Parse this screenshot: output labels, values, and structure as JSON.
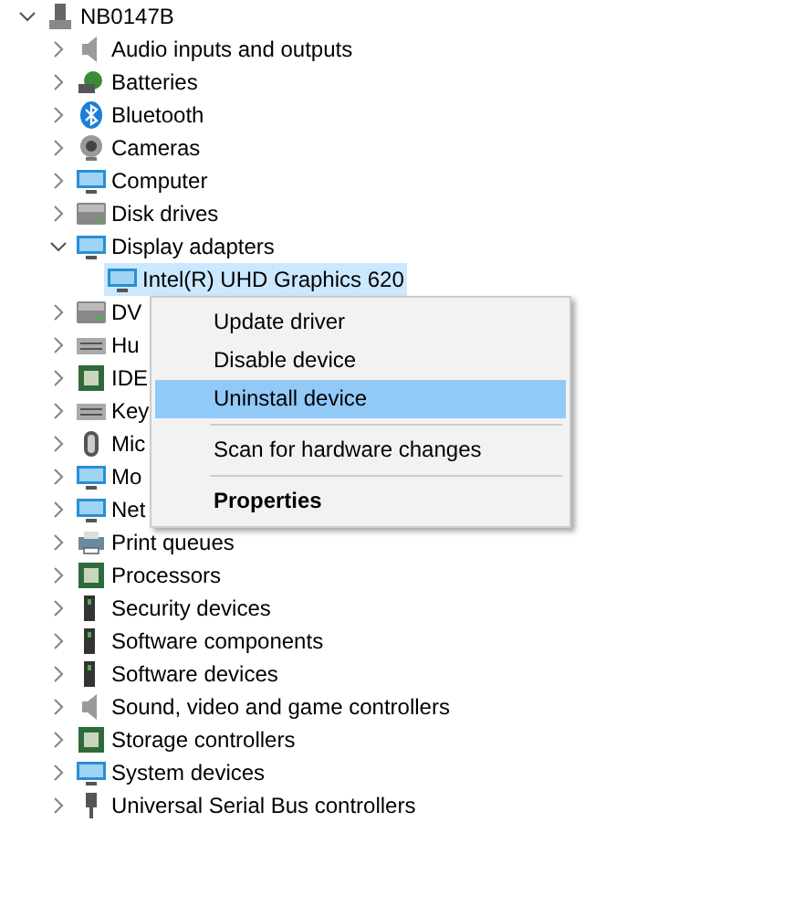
{
  "tree": {
    "label": "NB0147B",
    "expanded": true,
    "selected": false,
    "children": [
      {
        "label": "Audio inputs and outputs",
        "expanded": false,
        "selected": false
      },
      {
        "label": "Batteries",
        "expanded": false,
        "selected": false
      },
      {
        "label": "Bluetooth",
        "expanded": false,
        "selected": false
      },
      {
        "label": "Cameras",
        "expanded": false,
        "selected": false
      },
      {
        "label": "Computer",
        "expanded": false,
        "selected": false
      },
      {
        "label": "Disk drives",
        "expanded": false,
        "selected": false
      },
      {
        "label": "Display adapters",
        "expanded": true,
        "selected": false,
        "children": [
          {
            "label": "Intel(R) UHD Graphics 620",
            "selected": true
          }
        ]
      },
      {
        "label": "DV",
        "expanded": false,
        "selected": false
      },
      {
        "label": "Hu",
        "expanded": false,
        "selected": false
      },
      {
        "label": "IDE",
        "expanded": false,
        "selected": false
      },
      {
        "label": "Key",
        "expanded": false,
        "selected": false
      },
      {
        "label": "Mic",
        "expanded": false,
        "selected": false
      },
      {
        "label": "Mo",
        "expanded": false,
        "selected": false
      },
      {
        "label": "Net",
        "expanded": false,
        "selected": false
      },
      {
        "label": "Print queues",
        "expanded": false,
        "selected": false
      },
      {
        "label": "Processors",
        "expanded": false,
        "selected": false
      },
      {
        "label": "Security devices",
        "expanded": false,
        "selected": false
      },
      {
        "label": "Software components",
        "expanded": false,
        "selected": false
      },
      {
        "label": "Software devices",
        "expanded": false,
        "selected": false
      },
      {
        "label": "Sound, video and game controllers",
        "expanded": false,
        "selected": false
      },
      {
        "label": "Storage controllers",
        "expanded": false,
        "selected": false
      },
      {
        "label": "System devices",
        "expanded": false,
        "selected": false
      },
      {
        "label": "Universal Serial Bus controllers",
        "expanded": false,
        "selected": false
      }
    ]
  },
  "context_menu": {
    "items": [
      {
        "kind": "action",
        "label": "Update driver",
        "selected": false
      },
      {
        "kind": "action",
        "label": "Disable device",
        "selected": false
      },
      {
        "kind": "action",
        "label": "Uninstall device",
        "selected": true
      },
      {
        "kind": "separator"
      },
      {
        "kind": "action",
        "label": "Scan for hardware changes",
        "selected": false
      },
      {
        "kind": "separator"
      },
      {
        "kind": "default",
        "label": "Properties",
        "selected": false
      }
    ]
  }
}
